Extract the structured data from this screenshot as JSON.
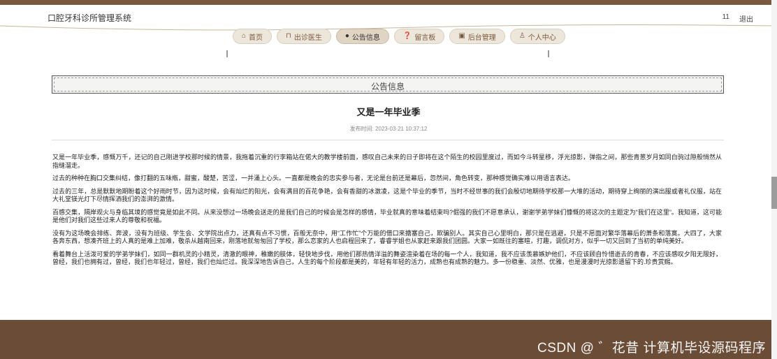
{
  "header": {
    "site_title": "口腔牙科诊所管理系统",
    "user_name": "11",
    "logout_label": "退出"
  },
  "nav": {
    "items": [
      {
        "label": "首页",
        "icon": "home-icon",
        "glyph": "⌂"
      },
      {
        "label": "出诊医生",
        "icon": "doctor-icon",
        "glyph": "⊓"
      },
      {
        "label": "公告信息",
        "icon": "notice-icon",
        "glyph": "●"
      },
      {
        "label": "留言板",
        "icon": "message-icon",
        "glyph": "❓"
      },
      {
        "label": "后台管理",
        "icon": "admin-icon",
        "glyph": "▣"
      },
      {
        "label": "个人中心",
        "icon": "user-icon",
        "glyph": "♙"
      }
    ],
    "active_index": 2
  },
  "section": {
    "title": "公告信息"
  },
  "article": {
    "title": "又是一年毕业季",
    "publish_label": "发布时间: 2023-03-21 10:37:12",
    "paragraphs": [
      "又是一年毕业季，感慨万千，还记的自己刚进学校那时候的情景，我拖着沉重的行李箱站在偌大的教学楼前面，感叹自己未来的日子即将在这个陌生的校园里度过，而如今斗转星移，浮光掠影，弹指之间，那些青葱岁月如同白驹过隙般悄然从指缝溜走。",
      "过去的种种在胸口交集纠结，像打翻的五味瓶，甜蜜，酸楚，苦涩，一并涌上心头。一直都是晚会的忠实参与者，无论是台前还是幕后，忽然间，角色转变，那种感觉确实难以用语言表达。",
      "过去的三年，总是默默地期盼着这个好雨时节，因为这时候，会有灿烂的阳光，会有满目的百花争艳，会有香甜的冰激凌，这是个毕业的季节，当时不经世事的我们会殷切地期待学校那一大堆的活动，期待穿上绚丽的演出服或者礼仪服，站在大礼堂镁光灯下尽情挥洒我们的澎湃的激情。",
      "百感交集，隔岸观火与身临其境的感觉竟是如此不同。从来没想过一场晚会送走的是我们自己的时候会是怎样的感情，毕业就真的意味着结束吗?倔强的我们不愿意承认，谢谢学弟学妹们慷慨的将这次的主题定为“我们在这里”。我知道，这可能是他们对我们这些过来人的尊敬和祝福。",
      "没有为这场晚会排练、奔波，没有为班级、学生会、文学院出点力，还真有点不习惯，百般无奈中，用“工作忙”个万能的借口来搪塞自己，欺骗别人。其实自己心里明白，那只是在逃避，只是不愿面对繁华落幕后的萧条和落寞。大四了，大家各奔东西，想凑齐班上的人真的是难上加难，敬杀从越南回来，刚落地就匆匆回了学校，那么恋家的人也启程回来了，睿睿学姐也从家赶来跟我们团圆。大家一如既往的塞暄，打趣，调侃对方，似乎一切又回到了当初的单纯美好。",
      "看着舞台上活泼可爱的学弟学妹们，如同一群机灵的小精灵，清澈的眼神，稚嫩的肢体，轻快地步伐，用他们那热情洋溢的舞姿渲染着在场的每一个人，我知道，我不应该羡慕嫉妒他们，不应该顾自怜惜逝去的青春，不应该感叹夕阳无限好，曾经，我们也拥有过，曾经，我们也年轻过，曾经，我们也灿烂过。我深深地告诉自己，人生的每个阶段都是美的，年轻有年轻的活力，成熟也有成熟的魅力。多一份稳重、淡然、优雅，也是漫漫时光掠影遗留下的.珍贵赏赐。"
    ]
  },
  "watermark": "CSDN @ ゛花昔  计算机毕设源码程序",
  "colors": {
    "brand_brown": "#7a5a3e",
    "footer_brown": "#6b4d37",
    "nav_bg": "#ede6da"
  }
}
